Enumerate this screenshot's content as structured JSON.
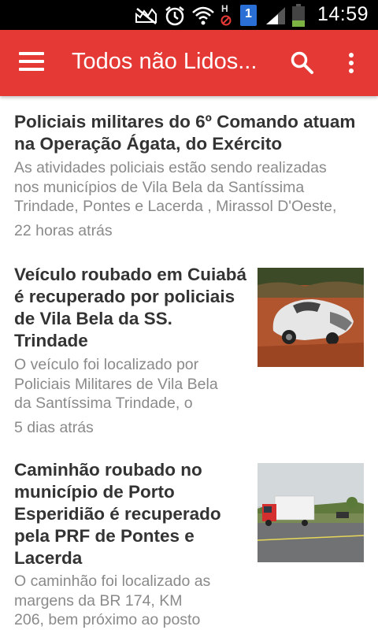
{
  "status_bar": {
    "time": "14:59",
    "sim_label": "1",
    "h_label": "H",
    "icons": [
      "mute-icon",
      "alarm-icon",
      "wifi-icon",
      "sim-icon",
      "signal-icon",
      "battery-icon"
    ]
  },
  "app_bar": {
    "title": "Todos não Lidos...",
    "color": "#e53935",
    "icons": [
      "menu-icon",
      "search-icon",
      "more-vert-icon"
    ]
  },
  "articles": [
    {
      "title_lines": [
        "Policiais militares do 6º Comando atuam",
        "na Operação Ágata, do Exército"
      ],
      "summary_lines": [
        "As atividades policiais estão sendo realizadas",
        "nos municípios de Vila Bela da Santíssima",
        "Trindade, Pontes e Lacerda , Mirassol D'Oeste,"
      ],
      "time": "22 horas atrás"
    },
    {
      "title_lines": [
        "Veículo roubado em Cuiabá",
        "é recuperado por policiais",
        "de Vila Bela da SS.",
        "Trindade"
      ],
      "summary_lines": [
        "O veículo foi localizado por",
        "Policiais Militares de Vila Bela",
        "da Santíssima Trindade, o"
      ],
      "time": "5 dias atrás",
      "thumbnail": "photo-crashed-white-car"
    },
    {
      "title_lines": [
        "Caminhão roubado no",
        "município de Porto",
        "Esperidião é recuperado",
        "pela PRF de Pontes e",
        "Lacerda"
      ],
      "summary_lines": [
        "O caminhão foi localizado as",
        "margens da BR 174, KM",
        "206, bem próximo ao posto"
      ],
      "thumbnail": "photo-red-truck-on-highway"
    }
  ]
}
